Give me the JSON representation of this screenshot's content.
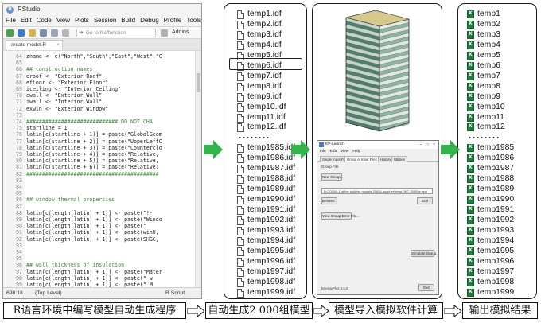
{
  "rstudio": {
    "title": "RStudio",
    "menu": [
      "File",
      "Edit",
      "Code",
      "View",
      "Plots",
      "Session",
      "Build",
      "Debug",
      "Profile",
      "Tools"
    ],
    "goto_placeholder": "Go to file/function",
    "addins": "Addins",
    "tab_label": "create model.R",
    "code_lines": [
      {
        "n": "64",
        "t": "zname <- c(\"North\",\"South\",\"East\",\"West\",\"C",
        "c": false
      },
      {
        "n": "65",
        "t": "",
        "c": false
      },
      {
        "n": "66",
        "t": "## construction names",
        "c": true
      },
      {
        "n": "67",
        "t": "eroof <- \"Exterior Roof\"",
        "c": false
      },
      {
        "n": "68",
        "t": "efloor <- \"Exterior Floor\"",
        "c": false
      },
      {
        "n": "69",
        "t": "iceiling <- \"Interior Ceiling\"",
        "c": false
      },
      {
        "n": "70",
        "t": "ewall <- \"Exterior Wall\"",
        "c": false
      },
      {
        "n": "71",
        "t": "iwall <- \"Interior Wall\"",
        "c": false
      },
      {
        "n": "72",
        "t": "exwin <- \"Exterior Window\"",
        "c": false
      },
      {
        "n": "73",
        "t": "",
        "c": false
      },
      {
        "n": "74",
        "t": "############################# DO NOT CHA",
        "c": true
      },
      {
        "n": "75",
        "t": "startline = 1",
        "c": false
      },
      {
        "n": "76",
        "t": "latin[c(startline + 1)] = paste(\"GlobalGeom",
        "c": false
      },
      {
        "n": "77",
        "t": "latin[c(startline + 2)] = paste(\"UpperLeftC",
        "c": false
      },
      {
        "n": "78",
        "t": "latin[c(startline + 3)] = paste(\"Counterclo",
        "c": false
      },
      {
        "n": "79",
        "t": "latin[c(startline + 4)] = paste(\"Relative,",
        "c": false
      },
      {
        "n": "80",
        "t": "latin[c(startline + 5)] = paste(\"Relative,",
        "c": false
      },
      {
        "n": "81",
        "t": "latin[c(startline + 6)] = paste(\"Relative;",
        "c": false
      },
      {
        "n": "82",
        "t": "##########################################",
        "c": true
      },
      {
        "n": "83",
        "t": "",
        "c": false
      },
      {
        "n": "84",
        "t": "",
        "c": false
      },
      {
        "n": "85",
        "t": "",
        "c": false
      },
      {
        "n": "86",
        "t": "## window thermal properties",
        "c": true
      },
      {
        "n": "87",
        "t": "",
        "c": false
      },
      {
        "n": "88",
        "t": "latin[c(length(latin) + 1)] <- paste(\"!- ",
        "c": false
      },
      {
        "n": "89",
        "t": "latin[c(length(latin) + 1)] <- paste(\"Windo",
        "c": false
      },
      {
        "n": "90",
        "t": "latin[c(length(latin) + 1)] <- paste(\"    ",
        "c": false
      },
      {
        "n": "91",
        "t": "latin[c(length(latin) + 1)] <- paste(winU,",
        "c": false
      },
      {
        "n": "92",
        "t": "latin[c(length(latin) + 1)] <- paste(SHGC,",
        "c": false
      },
      {
        "n": "93",
        "t": "",
        "c": false
      },
      {
        "n": "94",
        "t": "",
        "c": false
      },
      {
        "n": "95",
        "t": "",
        "c": false
      },
      {
        "n": "96",
        "t": "## wall thickness of insulation",
        "c": true
      },
      {
        "n": "97",
        "t": "latin[c(length(latin) + 1)] <- paste(\"Mater",
        "c": false
      },
      {
        "n": "98",
        "t": "latin[c(length(latin) + 1)] <- paste(\"   w",
        "c": false
      },
      {
        "n": "99",
        "t": "latin[c(length(latin) + 1)] <- paste(\"   M",
        "c": false
      }
    ],
    "status_left": "698:18",
    "status_mid": "(Top Level)",
    "status_right": "R Script"
  },
  "idf_files": [
    "temp1.idf",
    "temp2.idf",
    "temp3.idf",
    "temp4.idf",
    "temp5.idf",
    "temp6.idf",
    "temp7.idf",
    "temp8.idf",
    "temp9.idf",
    "temp10.idf",
    "temp11.idf",
    "temp12.idf",
    "temp1985.idf",
    "temp1986.idf",
    "temp1987.idf",
    "temp1988.idf",
    "temp1989.idf",
    "temp1990.idf",
    "temp1991.idf",
    "temp1992.idf",
    "temp1993.idf",
    "temp1994.idf",
    "temp1995.idf",
    "temp1996.idf",
    "temp1997.idf",
    "temp1998.idf",
    "temp1999.idf",
    "temp2000.idf"
  ],
  "result_files": [
    "temp1",
    "temp2",
    "temp3",
    "temp4",
    "temp5",
    "temp6",
    "temp7",
    "temp8",
    "temp9",
    "temp10",
    "temp11",
    "temp12",
    "temp1985",
    "temp1986",
    "temp1987",
    "temp1988",
    "temp1989",
    "temp1990",
    "temp1991",
    "temp1992",
    "temp1993",
    "temp1994",
    "temp1995",
    "temp1996",
    "temp1997",
    "temp1998",
    "temp1999",
    "temp2000"
  ],
  "ellipsis": "········",
  "ep_launch": {
    "title": "EP-Launch",
    "window_controls": "– □ ×",
    "menu": [
      "File",
      "Edit",
      "View",
      "Help"
    ],
    "tabs": [
      "Single Input File",
      "Group of Input Files",
      "History",
      "Utilities"
    ],
    "group_file_label": "Group File",
    "new_group": "New Group...",
    "path": "D:\\2020\\0-1\\office building models 2000\\Launcher\\temp1997-2000\\\\e.epg",
    "browse": "Browse...",
    "edit": "Edit",
    "view_errors": "View Group Error File...",
    "simulate": "Simulate Group...",
    "version": "EnergyPlus 8.5.0",
    "exit": "Exit"
  },
  "captions": [
    "R语言环境中编写模型自动生成程序",
    "自动生成2 000组模型",
    "模型导入模拟软件计算",
    "输出模拟结果"
  ],
  "colors": {
    "arrow_green": "#2fb54a",
    "comment_green": "#3e8a3e",
    "excel_green": "#1e7d3c",
    "building_glass": "#4f7d6e",
    "building_floor": "#c7d4c8"
  }
}
